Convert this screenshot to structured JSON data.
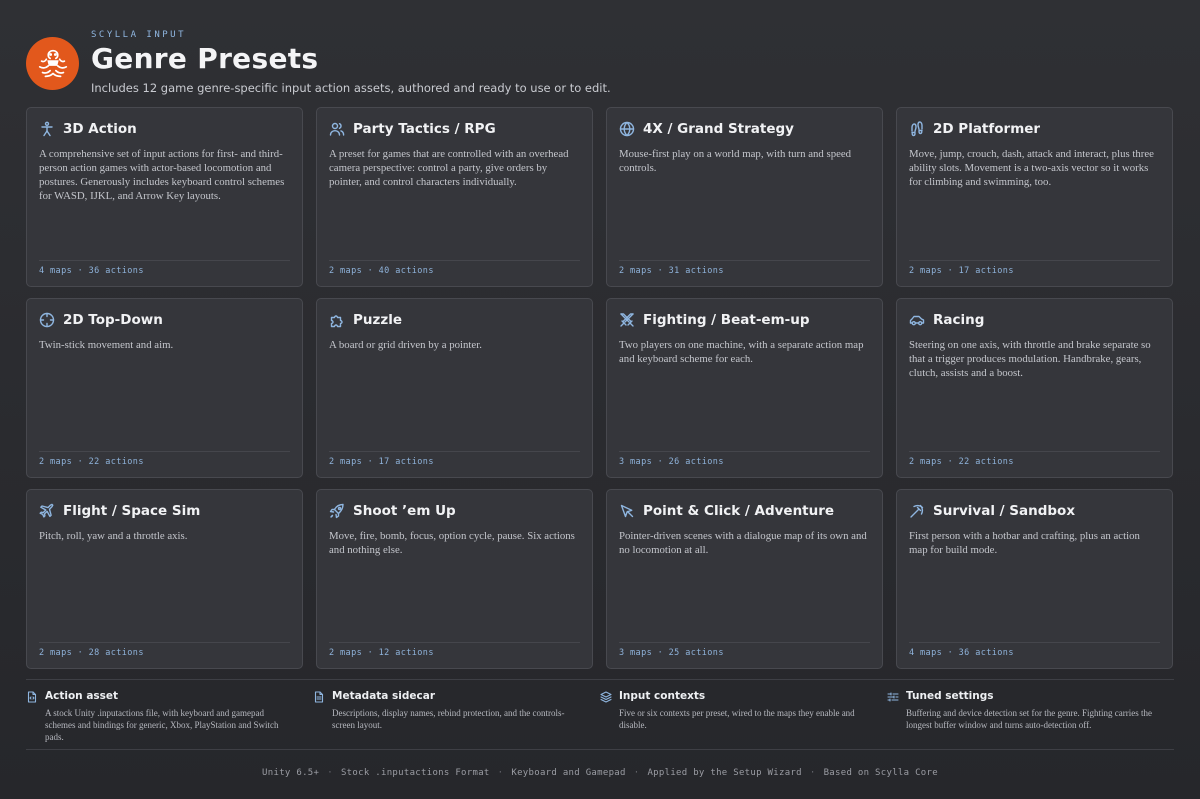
{
  "header": {
    "eyebrow": "SCYLLA INPUT",
    "title": "Genre Presets",
    "subtitle": "Includes 12 game genre-specific input action assets, authored and ready to use or to edit.",
    "logo_icon": "scylla-logo-icon",
    "accent": "#e2581c"
  },
  "cards": [
    {
      "icon": "person-icon",
      "title": "3D Action",
      "desc": "A comprehensive set of input actions for first- and third-person action games with actor-based locomotion and postures. Generously includes keyboard control schemes for WASD, IJKL, and Arrow Key layouts.",
      "meta": "4 maps · 36 actions"
    },
    {
      "icon": "users-icon",
      "title": "Party Tactics / RPG",
      "desc": "A preset for games that are controlled with an overhead camera perspective: control a party, give orders by pointer, and control characters individually.",
      "meta": "2 maps · 40 actions"
    },
    {
      "icon": "globe-icon",
      "title": "4X / Grand Strategy",
      "desc": "Mouse-first play on a world map, with turn and speed controls.",
      "meta": "2 maps · 31 actions"
    },
    {
      "icon": "footprints-icon",
      "title": "2D Platformer",
      "desc": "Move, jump, crouch, dash, attack and interact, plus three ability slots. Movement is a two-axis vector so it works for climbing and swimming, too.",
      "meta": "2 maps · 17 actions"
    },
    {
      "icon": "crosshair-icon",
      "title": "2D Top-Down",
      "desc": "Twin-stick movement and aim.",
      "meta": "2 maps · 22 actions"
    },
    {
      "icon": "puzzle-icon",
      "title": "Puzzle",
      "desc": "A board or grid driven by a pointer.",
      "meta": "2 maps · 17 actions"
    },
    {
      "icon": "swords-icon",
      "title": "Fighting / Beat-em-up",
      "desc": "Two players on one machine, with a separate action map and keyboard scheme for each.",
      "meta": "3 maps · 26 actions"
    },
    {
      "icon": "car-icon",
      "title": "Racing",
      "desc": "Steering on one axis, with throttle and brake separate so that a trigger produces modulation. Handbrake, gears, clutch, assists and a boost.",
      "meta": "2 maps · 22 actions"
    },
    {
      "icon": "plane-icon",
      "title": "Flight / Space Sim",
      "desc": "Pitch, roll, yaw and a throttle axis.",
      "meta": "2 maps · 28 actions"
    },
    {
      "icon": "rocket-icon",
      "title": "Shoot ’em Up",
      "desc": "Move, fire, bomb, focus, option cycle, pause. Six actions and nothing else.",
      "meta": "2 maps · 12 actions"
    },
    {
      "icon": "pointer-icon",
      "title": "Point & Click / Adventure",
      "desc": "Pointer-driven scenes with a dialogue map of its own and no locomotion at all.",
      "meta": "3 maps · 25 actions"
    },
    {
      "icon": "pickaxe-icon",
      "title": "Survival / Sandbox",
      "desc": "First person with a hotbar and crafting, plus an action map for build mode.",
      "meta": "4 maps · 36 actions"
    }
  ],
  "features": [
    {
      "icon": "file-code-icon",
      "title": "Action asset",
      "desc": "A stock Unity .inputactions file, with keyboard and gamepad schemes and bindings for generic, Xbox, PlayStation and Switch pads."
    },
    {
      "icon": "file-text-icon",
      "title": "Metadata sidecar",
      "desc": "Descriptions, display names, rebind protection, and the controls-screen layout."
    },
    {
      "icon": "layers-icon",
      "title": "Input contexts",
      "desc": "Five or six contexts per preset, wired to the maps they enable and disable."
    },
    {
      "icon": "sliders-icon",
      "title": "Tuned settings",
      "desc": "Buffering and device detection set for the genre. Fighting carries the longest buffer window and turns auto-detection off."
    }
  ],
  "footer": [
    "Unity 6.5+",
    "Stock .inputactions Format",
    "Keyboard and Gamepad",
    "Applied by the Setup Wizard",
    "Based on Scylla Core"
  ],
  "colors": {
    "background": "#2b2c30",
    "card": "#35363b",
    "icon_blue": "#8fb6e0",
    "meta_blue": "#8fb3db"
  }
}
